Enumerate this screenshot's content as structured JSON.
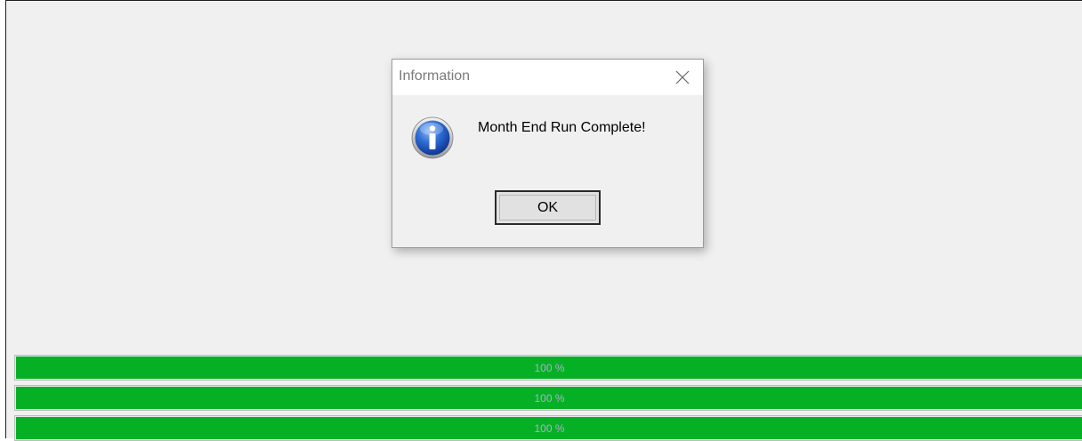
{
  "dialog": {
    "title": "Information",
    "message": "Month End Run Complete!",
    "ok_label": "OK",
    "icon": "info-icon",
    "close_icon": "close-icon"
  },
  "progress_bars": [
    {
      "label": "100 %",
      "value": 100
    },
    {
      "label": "100 %",
      "value": 100
    },
    {
      "label": "100 %",
      "value": 100
    }
  ],
  "colors": {
    "progress_fill": "#06b025",
    "progress_label": "#b5a7d8",
    "window_bg": "#f0f0f0",
    "dialog_titlebar": "#ffffff"
  }
}
